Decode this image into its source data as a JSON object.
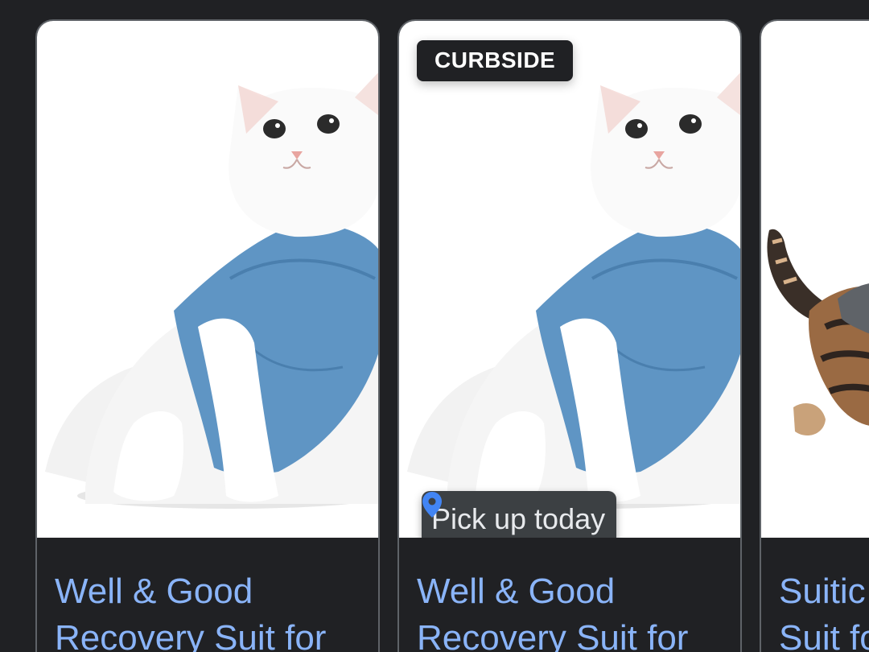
{
  "products": [
    {
      "title_line1": "Well & Good",
      "title_line2": "Recovery Suit for",
      "image_icon": "cat-in-blue-recovery-suit"
    },
    {
      "badge": "CURBSIDE",
      "pickup_label": "Pick up today",
      "pickup_icon": "location-pin-icon",
      "title_line1": "Well & Good",
      "title_line2": "Recovery Suit for",
      "image_icon": "cat-in-blue-recovery-suit"
    },
    {
      "title_line1": "Suitic",
      "title_line2": "Suit fo",
      "image_icon": "kitten-in-suit"
    }
  ],
  "colors": {
    "background": "#202124",
    "link": "#8ab4f8",
    "card_border": "#5f6368",
    "suit_blue": "#5f95c4",
    "pin_blue": "#4285f4"
  }
}
